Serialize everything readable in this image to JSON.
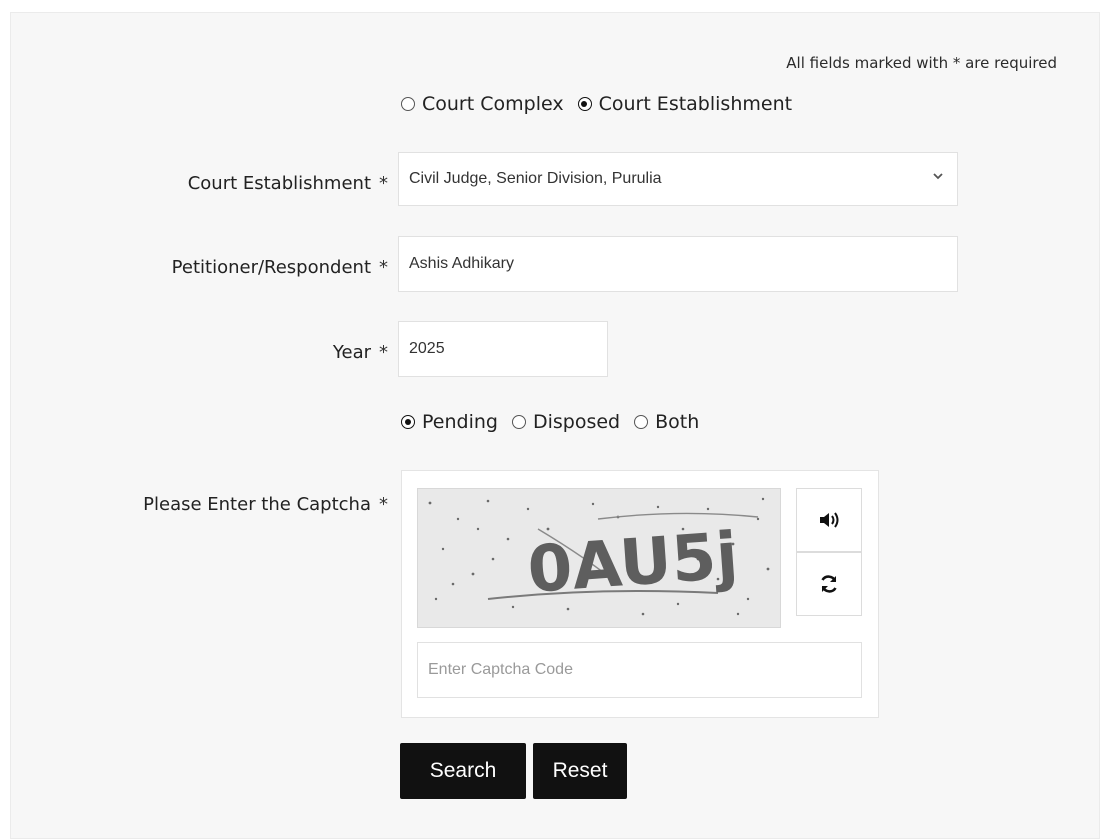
{
  "form": {
    "required_note": "All fields marked with * are required",
    "search_by": [
      {
        "label": "Court Complex",
        "checked": false
      },
      {
        "label": "Court Establishment",
        "checked": true
      }
    ],
    "court_establishment": {
      "label": "Court Establishment",
      "value": "Civil Judge, Senior Division, Purulia"
    },
    "party": {
      "label": "Petitioner/Respondent",
      "value": "Ashis Adhikary"
    },
    "year": {
      "label": "Year",
      "value": "2025"
    },
    "status": [
      {
        "label": "Pending",
        "checked": true
      },
      {
        "label": "Disposed",
        "checked": false
      },
      {
        "label": "Both",
        "checked": false
      }
    ],
    "captcha": {
      "label": "Please Enter the Captcha",
      "image_text": "0AU5j",
      "placeholder": "Enter Captcha Code",
      "audio_icon": "volume-icon",
      "refresh_icon": "refresh-icon"
    },
    "required_mark": "*",
    "buttons": {
      "search": "Search",
      "reset": "Reset"
    }
  }
}
